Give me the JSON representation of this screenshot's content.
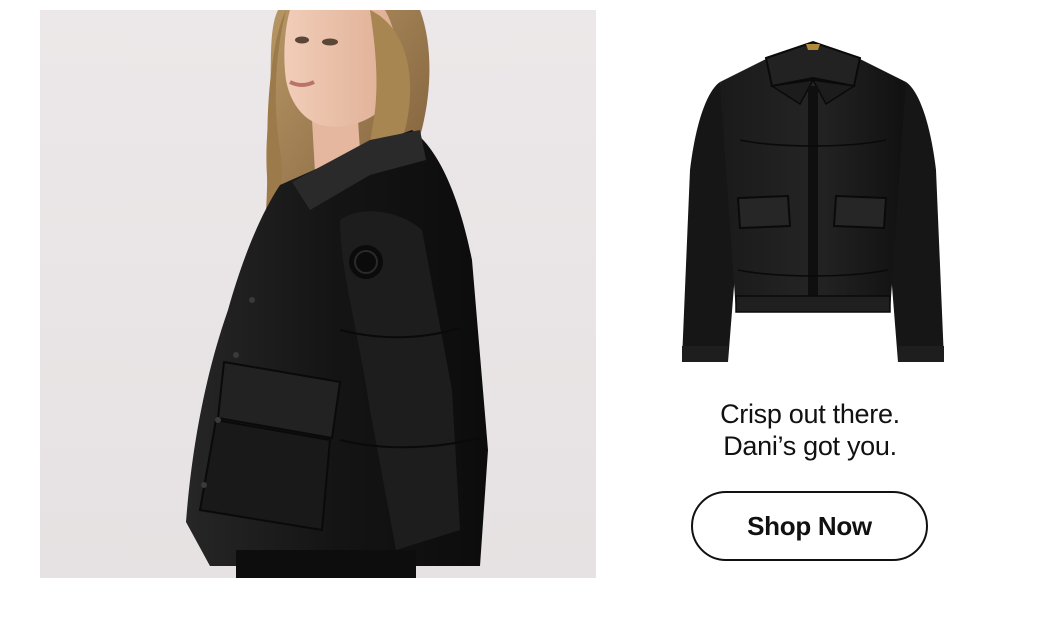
{
  "hero": {
    "background_color": "#eae6e7",
    "jacket_color": "#161616"
  },
  "product": {
    "jacket_color": "#121212",
    "zipper_pull_color": "#b08a3c"
  },
  "tagline": {
    "line1": "Crisp out there.",
    "line2": "Dani’s got you."
  },
  "cta": {
    "label": "Shop Now"
  }
}
